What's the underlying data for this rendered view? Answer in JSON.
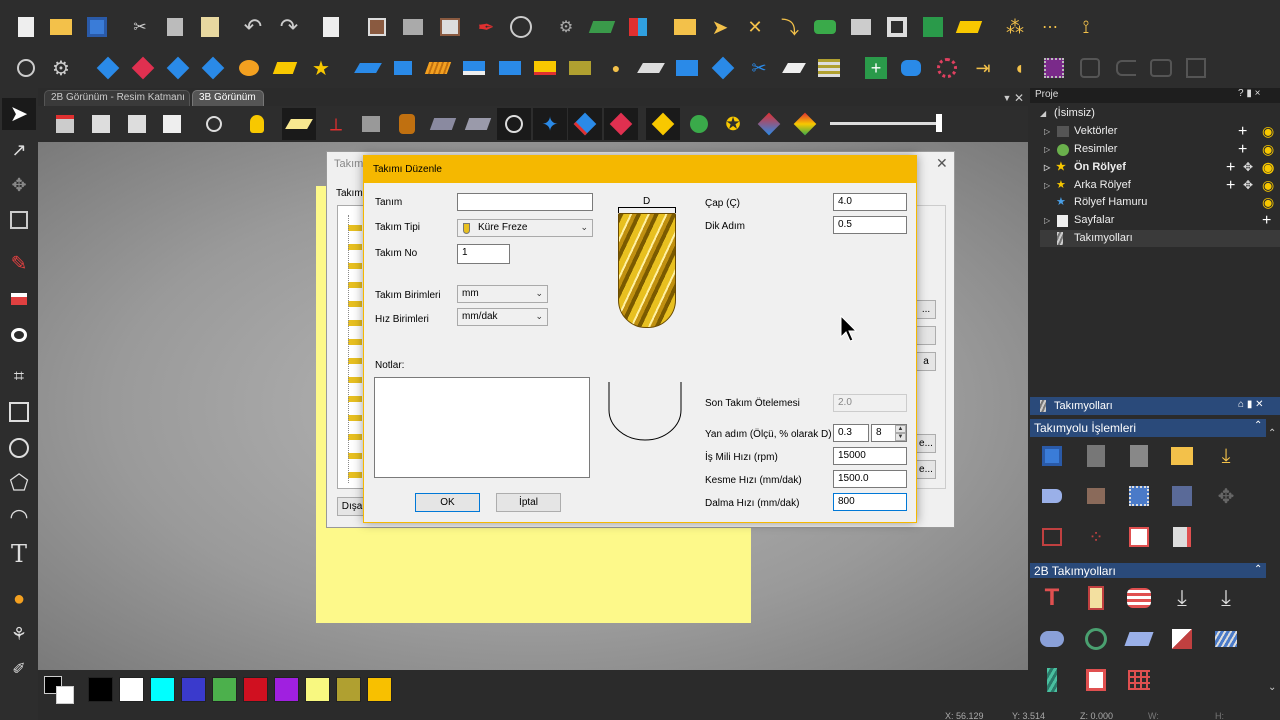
{
  "tabs": [
    "2B Görünüm - Resim Katmanı",
    "3B Görünüm"
  ],
  "background_dialog": {
    "title": "Takım",
    "label": "Takım",
    "bottom_button": "Dışa"
  },
  "dialog": {
    "title": "Takımı Düzenle",
    "tanim_label": "Tanım",
    "tanim_value": "",
    "takim_tipi_label": "Takım Tipi",
    "takim_tipi_value": "Küre Freze",
    "takim_no_label": "Takım No",
    "takim_no_value": "1",
    "takim_birimleri_label": "Takım Birimleri",
    "takim_birimleri_value": "mm",
    "hiz_birimleri_label": "Hız Birimleri",
    "hiz_birimleri_value": "mm/dak",
    "notlar_label": "Notlar:",
    "diagram_d_label": "D",
    "cap_label": "Çap (Ç)",
    "cap_value": "4.0",
    "dik_adim_label": "Dik Adım",
    "dik_adim_value": "0.5",
    "son_takim_label": "Son Takım Ötelemesi",
    "son_takim_value": "2.0",
    "yan_adim_label": "Yan adım (Ölçü, % olarak D)",
    "yan_adim_value": "0.3",
    "yan_adim_pct": "8",
    "is_mili_label": "İş Mili Hızı (rpm)",
    "is_mili_value": "15000",
    "kesme_label": "Kesme Hızı (mm/dak)",
    "kesme_value": "1500.0",
    "dalma_label": "Dalma Hızı (mm/dak)",
    "dalma_value": "800",
    "ok_label": "OK",
    "cancel_label": "İptal"
  },
  "project_panel": {
    "title": "Proje",
    "controls": "? ▮ ×",
    "items": [
      "(İsimsiz)",
      "Vektörler",
      "Resimler",
      "Ön Rölyef",
      "Arka Rölyef",
      "Rölyef Hamuru",
      "Sayfalar",
      "Takımyolları"
    ]
  },
  "toolpaths_panel": {
    "title": "Takımyolları",
    "section1": "Takımyolu İşlemleri",
    "section2": "2B Takımyolları"
  },
  "status_bar": {
    "x": "X: 56.129",
    "y": "Y: 3.514",
    "z": "Z: 0.000",
    "w": "W:",
    "h": "H:"
  },
  "colors": {
    "palette": [
      "#000000",
      "#ffffff",
      "#00ffff",
      "#3a3acc",
      "#4cb04c",
      "#d01020",
      "#a020e0",
      "#f8f880",
      "#b0a030",
      "#f8c000"
    ],
    "dialog_title_bar": "#f5b800",
    "workspace": "#9a9a9a",
    "sheet": "#fdf98a"
  }
}
